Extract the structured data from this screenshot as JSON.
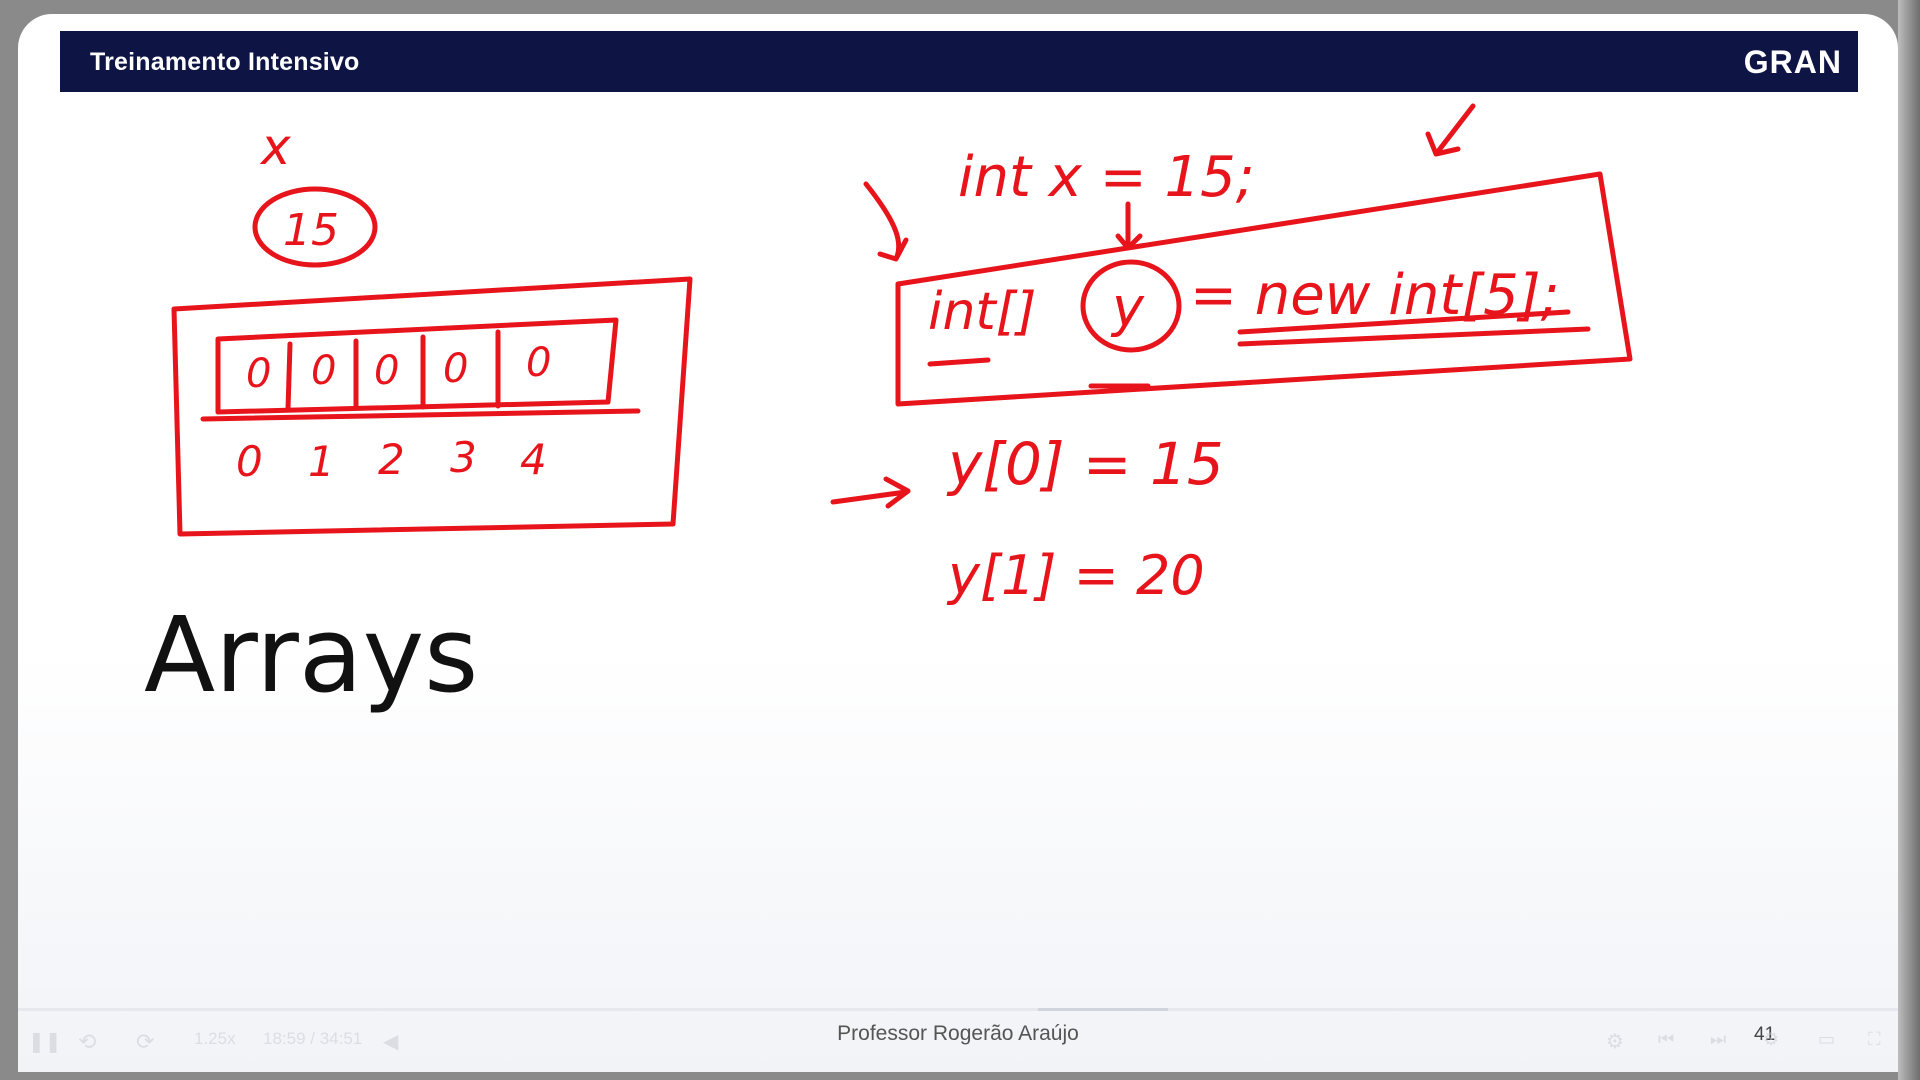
{
  "header": {
    "title": "Treinamento Intensivo",
    "brand": "GRAN"
  },
  "slide": {
    "heading": "Arrays",
    "presenter": "Professor Rogerão Araújo",
    "page_number": "41"
  },
  "annotations": {
    "var_label": "x",
    "var_value": "15",
    "array_cells": [
      "0",
      "0",
      "0",
      "0",
      "0"
    ],
    "array_indices": [
      "0",
      "1",
      "2",
      "3",
      "4"
    ],
    "code_line_1": "int x = 15;",
    "code_line_2_left": "int[]",
    "code_line_2_var": "y",
    "code_line_2_right": "= new int[5];",
    "assign_1": "y[0] = 15",
    "assign_2": "y[1] = 20"
  },
  "player": {
    "speed": "1.25x",
    "time": "18:59 / 34:51",
    "icons": [
      "pause-icon",
      "rewind-icon",
      "forward-icon",
      "volume-icon",
      "settings-icon",
      "prev-icon",
      "next-icon",
      "pip-icon",
      "fullscreen-icon"
    ]
  },
  "colors": {
    "header_bg": "#0e1545",
    "ink": "#e8141b"
  }
}
